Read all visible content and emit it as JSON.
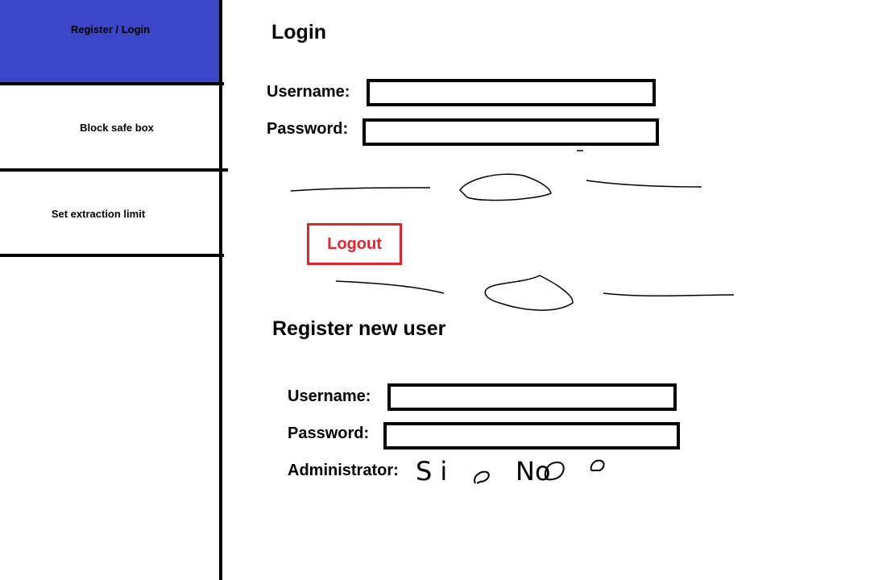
{
  "sidebar": {
    "items": [
      {
        "label": "Register / Login"
      },
      {
        "label": "Block safe box"
      },
      {
        "label": "Set extraction limit"
      }
    ]
  },
  "login": {
    "title": "Login",
    "username_label": "Username:",
    "password_label": "Password:",
    "username_value": "",
    "password_value": "",
    "logout_label": "Logout"
  },
  "register": {
    "title": "Register new user",
    "username_label": "Username:",
    "password_label": "Password:",
    "username_value": "",
    "password_value": "",
    "admin_label": "Administrator:",
    "admin_options": [
      "Si",
      "No"
    ]
  },
  "colors": {
    "sidebar_active": "#3c46c8",
    "logout": "#e2242c"
  }
}
